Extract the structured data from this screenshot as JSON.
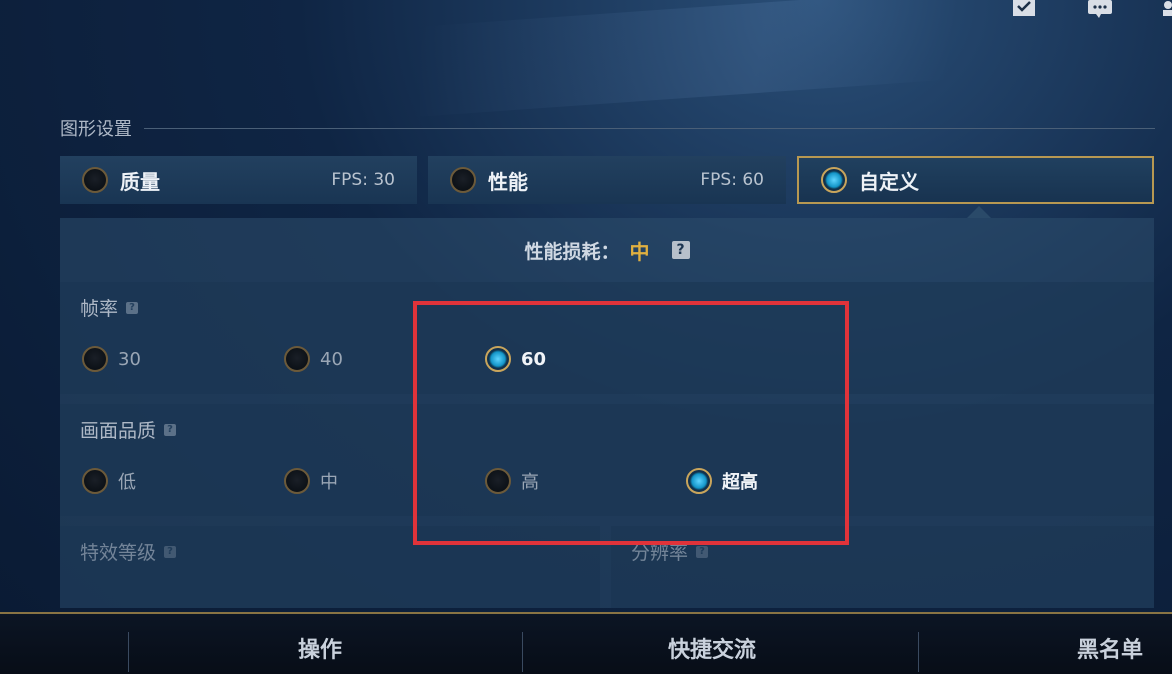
{
  "top_icons": [
    "check-icon",
    "chat-icon",
    "user-icon"
  ],
  "section": {
    "title": "图形设置"
  },
  "presets": [
    {
      "label": "质量",
      "fps": "FPS: 30",
      "selected": false
    },
    {
      "label": "性能",
      "fps": "FPS: 60",
      "selected": false
    },
    {
      "label": "自定义",
      "fps": "",
      "selected": true
    }
  ],
  "performance": {
    "label": "性能损耗：",
    "value": "中",
    "help": "?"
  },
  "frame_rate": {
    "title": "帧率",
    "options": [
      {
        "label": "30",
        "selected": false
      },
      {
        "label": "40",
        "selected": false
      },
      {
        "label": "60",
        "selected": true
      }
    ]
  },
  "graphics_quality": {
    "title": "画面品质",
    "options": [
      {
        "label": "低",
        "selected": false
      },
      {
        "label": "中",
        "selected": false
      },
      {
        "label": "高",
        "selected": false
      },
      {
        "label": "超高",
        "selected": true
      }
    ]
  },
  "effects_level": {
    "title": "特效等级"
  },
  "resolution": {
    "title": "分辨率"
  },
  "bottom_tabs": [
    "操作",
    "快捷交流",
    "黑名单"
  ],
  "colors": {
    "accent_gold": "#c9a55c",
    "value_yellow": "#e0b040",
    "highlight_red": "#e0333a",
    "radio_blue": "#1496c9"
  }
}
